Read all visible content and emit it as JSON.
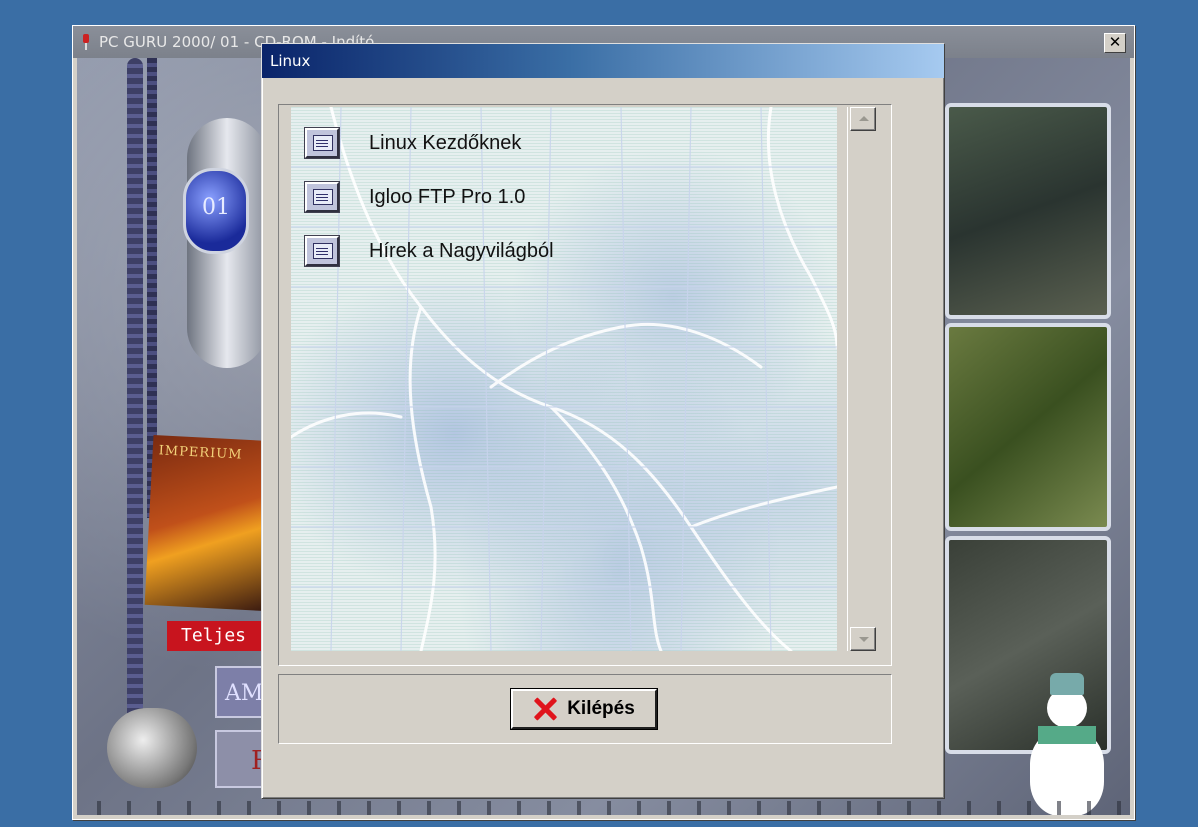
{
  "background_window": {
    "title": "PC GURU 2000/ 01 - CD-ROM - Indító",
    "close_glyph": "✕",
    "orb_text": "01",
    "poster_text": "IMPERIUM",
    "red_label": "Teljes",
    "button1_text": "AMI",
    "button2_text": "R"
  },
  "dialog": {
    "title": "Linux",
    "items": [
      {
        "label": "Linux Kezdőknek",
        "icon": "document-window-icon"
      },
      {
        "label": "Igloo FTP Pro 1.0",
        "icon": "document-window-icon"
      },
      {
        "label": "Hírek a Nagyvilágból",
        "icon": "document-window-icon"
      }
    ],
    "exit_button": {
      "label": "Kilépés",
      "icon": "red-x-icon",
      "icon_color": "#e0141c"
    }
  },
  "colors": {
    "desktop": "#3a6ea5",
    "dialog_face": "#d4d0c8",
    "titlebar_start": "#0a246a",
    "titlebar_end": "#a6caf0"
  }
}
